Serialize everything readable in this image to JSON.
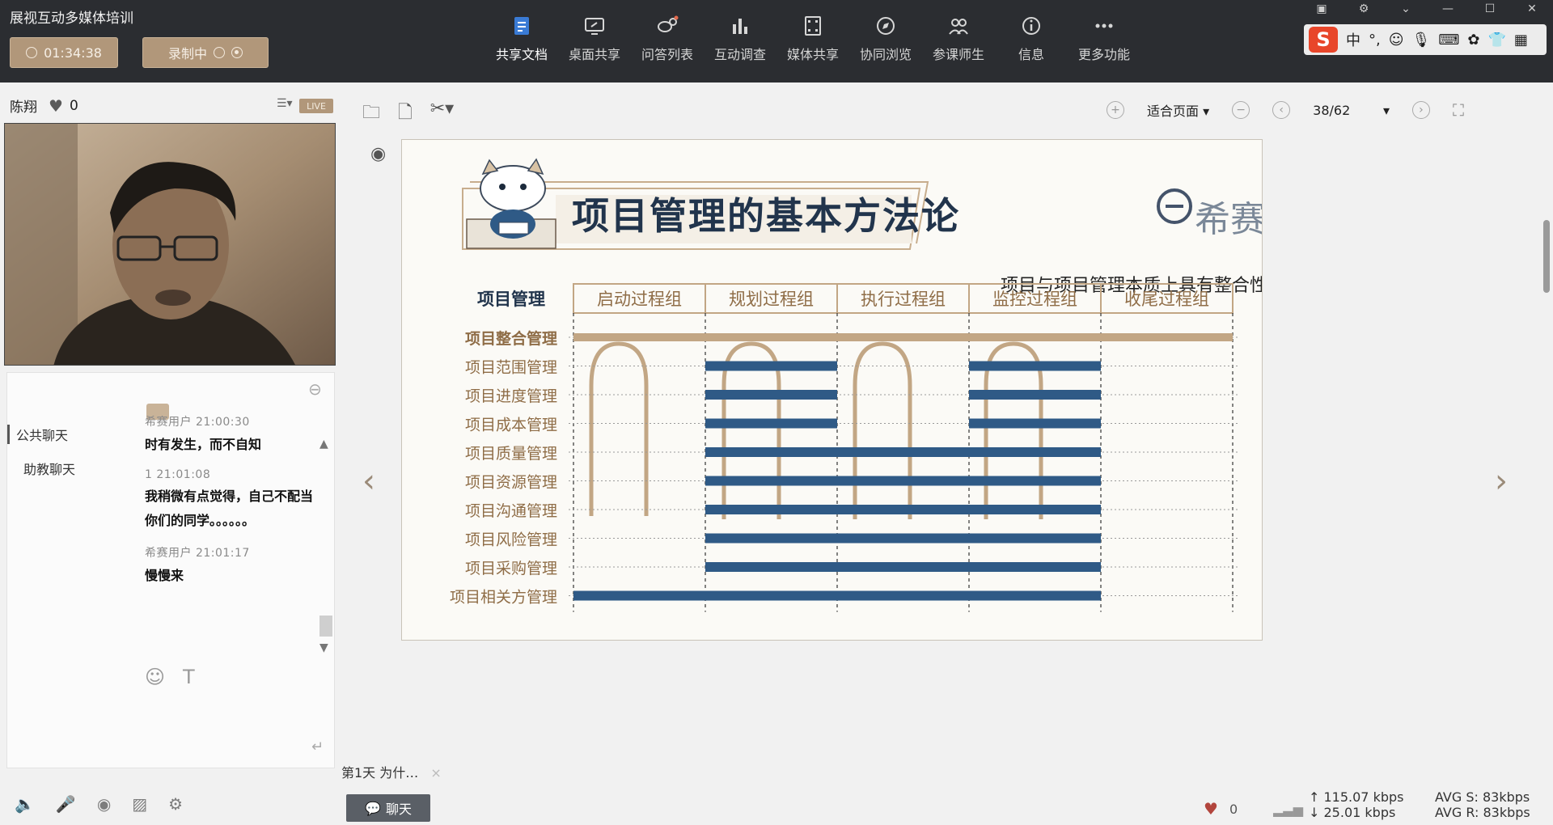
{
  "app": {
    "title": "展视互动多媒体培训",
    "timer": "01:34:38",
    "recording_label": "录制中"
  },
  "toolbar": [
    {
      "label": "共享文档",
      "icon": "document-icon",
      "active": true
    },
    {
      "label": "桌面共享",
      "icon": "desktop-share-icon"
    },
    {
      "label": "问答列表",
      "icon": "qa-list-icon"
    },
    {
      "label": "互动调查",
      "icon": "survey-chart-icon"
    },
    {
      "label": "媒体共享",
      "icon": "film-icon"
    },
    {
      "label": "协同浏览",
      "icon": "compass-icon"
    },
    {
      "label": "参课师生",
      "icon": "participants-icon"
    },
    {
      "label": "信息",
      "icon": "info-icon"
    },
    {
      "label": "更多功能",
      "icon": "more-icon"
    }
  ],
  "ime": {
    "mode": "中",
    "punct": "°,"
  },
  "user": {
    "name": "陈翔",
    "likes": "0",
    "live": "LIVE"
  },
  "chat": {
    "tabs": [
      "公共聊天",
      "助教聊天"
    ],
    "messages": [
      {
        "meta": "希赛用户 21:00:30",
        "text": "时有发生，而不自知"
      },
      {
        "meta": "1 21:01:08",
        "text": "我稍微有点觉得，自己不配当你们的同学。。。。。。"
      },
      {
        "meta": "希赛用户 21:01:17",
        "text": "慢慢来"
      }
    ]
  },
  "doc": {
    "zoom_label": "适合页面",
    "page": "38/62",
    "tab_label": "第1天 为什…",
    "close": "×"
  },
  "slide": {
    "title": "项目管理的基本方法论",
    "brand": "希赛",
    "subtitle": "项目与项目管理本质上具有整合性质。如项目估算。",
    "row_header": "项目管理",
    "columns": [
      "启动过程组",
      "规划过程组",
      "执行过程组",
      "监控过程组",
      "收尾过程组"
    ],
    "rows": [
      {
        "label": "项目整合管理",
        "span": [
          0,
          5
        ],
        "style": "gold"
      },
      {
        "label": "项目范围管理",
        "segments": [
          [
            1,
            2
          ],
          [
            3,
            4
          ]
        ]
      },
      {
        "label": "项目进度管理",
        "segments": [
          [
            1,
            2
          ],
          [
            3,
            4
          ]
        ]
      },
      {
        "label": "项目成本管理",
        "segments": [
          [
            1,
            2
          ],
          [
            3,
            4
          ]
        ]
      },
      {
        "label": "项目质量管理",
        "segments": [
          [
            1,
            4
          ]
        ]
      },
      {
        "label": "项目资源管理",
        "segments": [
          [
            1,
            4
          ]
        ]
      },
      {
        "label": "项目沟通管理",
        "segments": [
          [
            1,
            4
          ]
        ]
      },
      {
        "label": "项目风险管理",
        "segments": [
          [
            1,
            4
          ]
        ]
      },
      {
        "label": "项目采购管理",
        "segments": [
          [
            1,
            4
          ]
        ]
      },
      {
        "label": "项目相关方管理",
        "segments": [
          [
            0,
            4
          ]
        ]
      }
    ],
    "colors": {
      "blue": "#2f5a86",
      "gold": "#c2a684",
      "title": "#21344c"
    }
  },
  "footer": {
    "chat_button": "聊天",
    "likes": "0",
    "kbps_up": "115.07 kbps",
    "kbps_down": "25.01 kbps",
    "avg_s": "AVG S: 83kbps",
    "avg_r": "AVG R: 83kbps"
  }
}
